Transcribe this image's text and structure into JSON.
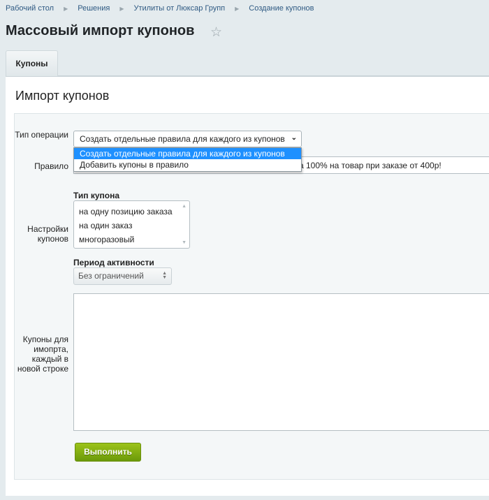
{
  "breadcrumbs": [
    "Рабочий стол",
    "Решения",
    "Утилиты от Люксар Групп",
    "Создание купонов"
  ],
  "page_title": "Массовый импорт купонов",
  "tabs": [
    {
      "label": "Купоны",
      "active": true
    }
  ],
  "panel_title": "Импорт купонов",
  "form": {
    "operation_label": "Тип операции",
    "operation_value": "Создать отдельные правила для каждого из купонов",
    "operation_options": [
      "Создать отдельные правила для каждого из купонов",
      "Добавить купоны в правило"
    ],
    "rule_label": "Правило",
    "rule_value_visible": "а 100% на товар при заказе от 400р!",
    "settings_label": "Настройки купонов",
    "coupon_type_label": "Тип купона",
    "coupon_types": [
      "на одну позицию заказа",
      "на один заказ",
      "многоразовый"
    ],
    "period_label": "Период активности",
    "period_value": "Без ограничений",
    "coupons_label": "Купоны для имопрта, каждый в новой строке",
    "coupons_value": "",
    "submit_label": "Выполнить"
  },
  "colors": {
    "accent": "#1e90ff",
    "button": "#86b012"
  }
}
